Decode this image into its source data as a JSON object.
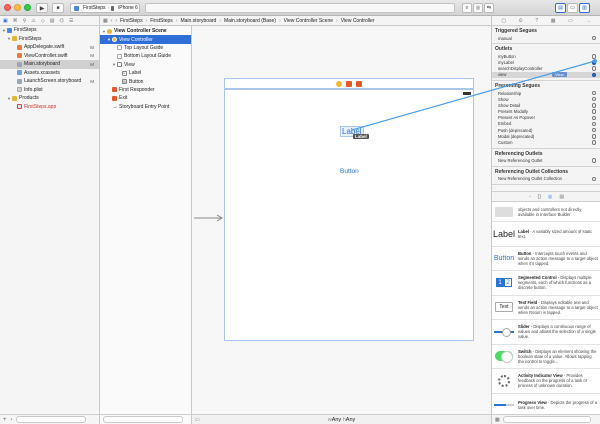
{
  "toolbar": {
    "run": "▶",
    "stop": "■",
    "scheme_app": "FirstSteps",
    "scheme_sep": "›",
    "scheme_device": "iPhone 6"
  },
  "navigator": {
    "tabs": [
      "▣",
      "⌘",
      "⚲",
      "⚠",
      "◇",
      "▤",
      "⌬",
      "☰"
    ],
    "items": [
      {
        "label": "FirstSteps",
        "badge": "",
        "indent": 0,
        "icon": "proj",
        "disc": "▼"
      },
      {
        "label": "FirstSteps",
        "badge": "",
        "indent": 1,
        "icon": "folder",
        "disc": "▼"
      },
      {
        "label": "AppDelegate.swift",
        "badge": "M",
        "indent": 2,
        "icon": "swift",
        "disc": ""
      },
      {
        "label": "ViewController.swift",
        "badge": "M",
        "indent": 2,
        "icon": "swift",
        "disc": ""
      },
      {
        "label": "Main.storyboard",
        "badge": "M",
        "indent": 2,
        "icon": "sb",
        "disc": "",
        "selected": true
      },
      {
        "label": "Assets.xcassets",
        "badge": "",
        "indent": 2,
        "icon": "assets",
        "disc": ""
      },
      {
        "label": "LaunchScreen.storyboard",
        "badge": "M",
        "indent": 2,
        "icon": "sb",
        "disc": ""
      },
      {
        "label": "Info.plist",
        "badge": "",
        "indent": 2,
        "icon": "plist",
        "disc": ""
      },
      {
        "label": "Products",
        "badge": "",
        "indent": 1,
        "icon": "folder",
        "disc": "▼"
      },
      {
        "label": "FirstSteps.app",
        "badge": "",
        "indent": 2,
        "icon": "app",
        "disc": "",
        "red": true
      }
    ]
  },
  "jumpbar": {
    "crumbs": [
      "FirstSteps",
      "FirstSteps",
      "Main.storyboard",
      "Main.storyboard (Base)",
      "View Controller Scene",
      "View Controller"
    ]
  },
  "outline": {
    "items": [
      {
        "label": "View Controller Scene",
        "indent": 0,
        "icon": "scene",
        "disc": "▼",
        "bold": true
      },
      {
        "label": "View Controller",
        "indent": 1,
        "icon": "vc",
        "disc": "▼",
        "selected": true
      },
      {
        "label": "Top Layout Guide",
        "indent": 2,
        "icon": "guide",
        "disc": ""
      },
      {
        "label": "Bottom Layout Guide",
        "indent": 2,
        "icon": "guide",
        "disc": ""
      },
      {
        "label": "View",
        "indent": 2,
        "icon": "view",
        "disc": "▼"
      },
      {
        "label": "Label",
        "indent": 3,
        "icon": "label",
        "disc": ""
      },
      {
        "label": "Button",
        "indent": 3,
        "icon": "button",
        "disc": ""
      },
      {
        "label": "First Responder",
        "indent": 1,
        "icon": "fr",
        "disc": ""
      },
      {
        "label": "Exit",
        "indent": 1,
        "icon": "exit",
        "disc": ""
      },
      {
        "label": "Storyboard Entry Point",
        "indent": 1,
        "icon": "arrow",
        "disc": ""
      }
    ]
  },
  "canvas": {
    "label_text": "Label",
    "tooltip_text": "Label",
    "button_text": "Button",
    "size_w": "Any",
    "size_h": "Any",
    "size_w_prefix": "w",
    "size_h_prefix": "h"
  },
  "inspector": {
    "tabs": [
      "▢",
      "⏲",
      "?",
      "▦",
      "▭",
      "→"
    ],
    "sections": [
      {
        "title": "Triggered Segues",
        "rows": [
          {
            "label": "manual",
            "filled": false
          }
        ]
      },
      {
        "title": "Outlets",
        "rows": [
          {
            "label": "myButton",
            "filled": false
          },
          {
            "label": "myLabel",
            "filled": true
          },
          {
            "label": "searchDisplayController",
            "filled": false
          },
          {
            "label": "view",
            "filled": true,
            "hl": true,
            "tip": "View"
          }
        ]
      },
      {
        "title": "Presenting Segues",
        "rows": [
          {
            "label": "Relationship",
            "filled": false
          },
          {
            "label": "Show",
            "filled": false
          },
          {
            "label": "Show Detail",
            "filled": false
          },
          {
            "label": "Present Modally",
            "filled": false
          },
          {
            "label": "Present As Popover",
            "filled": false
          },
          {
            "label": "Embed",
            "filled": false
          },
          {
            "label": "Push (deprecated)",
            "filled": false
          },
          {
            "label": "Modal (deprecated)",
            "filled": false
          },
          {
            "label": "Custom",
            "filled": false
          }
        ]
      },
      {
        "title": "Referencing Outlets",
        "rows": [
          {
            "label": "New Referencing Outlet",
            "filled": false
          }
        ]
      },
      {
        "title": "Referencing Outlet Collections",
        "rows": [
          {
            "label": "New Referencing Outlet Collection",
            "filled": false
          }
        ]
      }
    ]
  },
  "library": {
    "tabs": [
      "▫",
      "{}",
      "◎",
      "▤"
    ],
    "items": [
      {
        "thumb": "objects",
        "name": "",
        "desc": "objects and controllers not directly available in Interface Builder."
      },
      {
        "thumb": "label",
        "name": "Label",
        "desc": " - A variably sized amount of static text."
      },
      {
        "thumb": "button",
        "name": "Button",
        "desc": " - Intercepts touch events and sends an action message to a target object when it's tapped."
      },
      {
        "thumb": "seg",
        "name": "Segmented Control",
        "desc": " - Displays multiple segments, each of which functions as a discrete button."
      },
      {
        "thumb": "text",
        "name": "Text Field",
        "desc": " - Displays editable text and sends an action message to a target object when Return is tapped."
      },
      {
        "thumb": "slider",
        "name": "Slider",
        "desc": " - Displays a continuous range of values and allows the selection of a single value."
      },
      {
        "thumb": "switch",
        "name": "Switch",
        "desc": " - Displays an element showing the boolean state of a value. Allows tapping the control to toggle..."
      },
      {
        "thumb": "spinner",
        "name": "Activity Indicator View",
        "desc": " - Provides feedback on the progress of a task or process of unknown duration."
      },
      {
        "thumb": "progress",
        "name": "Progress View",
        "desc": " - Depicts the progress of a task over time."
      }
    ],
    "thumb_text": {
      "label": "Label",
      "button": "Button",
      "seg_1": "1",
      "seg_2": "2",
      "text": "Text"
    }
  }
}
